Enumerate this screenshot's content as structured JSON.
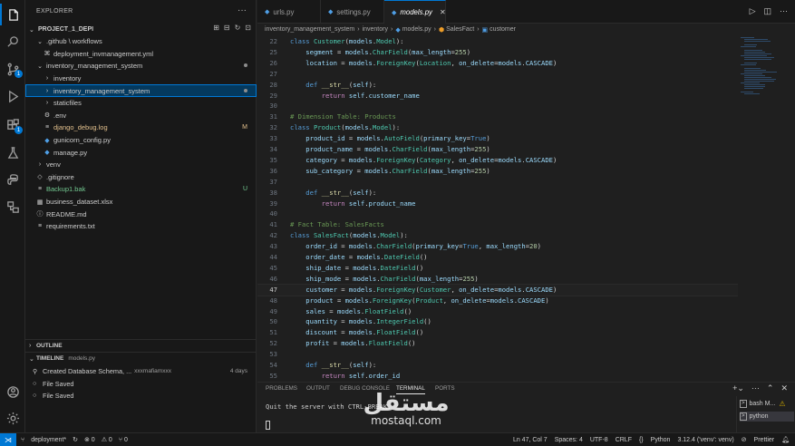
{
  "activity": {
    "items": [
      {
        "name": "explorer-icon",
        "label": "Explorer"
      },
      {
        "name": "search-icon",
        "label": "Search"
      },
      {
        "name": "source-control-icon",
        "label": "Source Control",
        "badge": "1"
      },
      {
        "name": "run-debug-icon",
        "label": "Run and Debug"
      },
      {
        "name": "extensions-icon",
        "label": "Extensions",
        "badge": "1"
      },
      {
        "name": "testing-icon",
        "label": "Testing"
      },
      {
        "name": "python-icon",
        "label": "Python"
      },
      {
        "name": "remote-explorer-icon",
        "label": "Remote Explorer"
      }
    ]
  },
  "explorer": {
    "title": "EXPLORER",
    "more": "···",
    "project": "PROJECT_1_DEPI",
    "items": [
      {
        "label": ".github \\ workflows",
        "icon": "⌄",
        "indent": 1,
        "git": ""
      },
      {
        "label": "deployment_invmanagement.yml",
        "icon": "⌘",
        "indent": 2,
        "git": ""
      },
      {
        "label": "inventory_management_system",
        "icon": "⌄",
        "indent": 1,
        "git": "dot"
      },
      {
        "label": "inventory",
        "icon": "›",
        "indent": 2,
        "git": ""
      },
      {
        "label": "inventory_management_system",
        "icon": "›",
        "indent": 2,
        "git": "dot",
        "selected": true
      },
      {
        "label": "staticfiles",
        "icon": "›",
        "indent": 2,
        "git": ""
      },
      {
        "label": ".env",
        "icon": "⚙",
        "indent": 2,
        "git": ""
      },
      {
        "label": "django_debug.log",
        "icon": "≡",
        "indent": 2,
        "git": "M"
      },
      {
        "label": "gunicorn_config.py",
        "icon": "◆",
        "indent": 2,
        "git": ""
      },
      {
        "label": "manage.py",
        "icon": "◆",
        "indent": 2,
        "git": ""
      },
      {
        "label": "venv",
        "icon": "›",
        "indent": 1,
        "git": ""
      },
      {
        "label": ".gitignore",
        "icon": "◇",
        "indent": 1,
        "git": ""
      },
      {
        "label": "Backup1.bak",
        "icon": "≡",
        "indent": 1,
        "git": "U"
      },
      {
        "label": "business_dataset.xlsx",
        "icon": "▦",
        "indent": 1,
        "git": ""
      },
      {
        "label": "README.md",
        "icon": "ⓘ",
        "indent": 1,
        "git": ""
      },
      {
        "label": "requirements.txt",
        "icon": "≡",
        "indent": 1,
        "git": ""
      }
    ],
    "outline": "OUTLINE",
    "timeline": "TIMELINE",
    "timeline_file": "models.py",
    "timeline_items": [
      {
        "icon": "⚲",
        "label": "Created Database Schema, ...",
        "sub": "xxxmafiamxxx",
        "time": "4 days"
      },
      {
        "icon": "○",
        "label": "File Saved",
        "sub": "",
        "time": ""
      },
      {
        "icon": "○",
        "label": "File Saved",
        "sub": "",
        "time": ""
      }
    ]
  },
  "tabs": [
    {
      "label": "urls.py",
      "active": false
    },
    {
      "label": "settings.py",
      "active": false
    },
    {
      "label": "models.py",
      "active": true
    }
  ],
  "breadcrumb": {
    "parts": [
      "inventory_management_system",
      "inventory",
      "models.py",
      "SalesFact",
      "customer"
    ]
  },
  "code": {
    "current_line": 47,
    "lines": [
      {
        "n": "22",
        "t": [
          [
            "class ",
            "k"
          ],
          [
            "Customer",
            "c"
          ],
          [
            "(",
            "p"
          ],
          [
            "models",
            "v"
          ],
          [
            ".",
            "p"
          ],
          [
            "Model",
            "c"
          ],
          [
            "):",
            "p"
          ]
        ]
      },
      {
        "n": "25",
        "t": [
          [
            "    segment ",
            "v"
          ],
          [
            "= ",
            "p"
          ],
          [
            "models",
            "v"
          ],
          [
            ".",
            "p"
          ],
          [
            "CharField",
            "c"
          ],
          [
            "(",
            "p"
          ],
          [
            "max_length",
            "v"
          ],
          [
            "=",
            "p"
          ],
          [
            "255",
            "n"
          ],
          [
            ")",
            "p"
          ]
        ]
      },
      {
        "n": "26",
        "t": [
          [
            "    location ",
            "v"
          ],
          [
            "= ",
            "p"
          ],
          [
            "models",
            "v"
          ],
          [
            ".",
            "p"
          ],
          [
            "ForeignKey",
            "c"
          ],
          [
            "(",
            "p"
          ],
          [
            "Location",
            "c"
          ],
          [
            ", ",
            "p"
          ],
          [
            "on_delete",
            "v"
          ],
          [
            "=",
            "p"
          ],
          [
            "models",
            "v"
          ],
          [
            ".",
            "p"
          ],
          [
            "CASCADE",
            "v"
          ],
          [
            ")",
            "p"
          ]
        ]
      },
      {
        "n": "27",
        "t": []
      },
      {
        "n": "28",
        "t": [
          [
            "    def ",
            "k"
          ],
          [
            "__str__",
            "f"
          ],
          [
            "(",
            "p"
          ],
          [
            "self",
            "v"
          ],
          [
            "):",
            "p"
          ]
        ]
      },
      {
        "n": "29",
        "t": [
          [
            "        return ",
            "kw"
          ],
          [
            "self",
            "v"
          ],
          [
            ".",
            "p"
          ],
          [
            "customer_name",
            "v"
          ]
        ]
      },
      {
        "n": "30",
        "t": []
      },
      {
        "n": "31",
        "t": [
          [
            "# Dimension Table: Products",
            "cm"
          ]
        ]
      },
      {
        "n": "32",
        "t": [
          [
            "class ",
            "k"
          ],
          [
            "Product",
            "c"
          ],
          [
            "(",
            "p"
          ],
          [
            "models",
            "v"
          ],
          [
            ".",
            "p"
          ],
          [
            "Model",
            "c"
          ],
          [
            "):",
            "p"
          ]
        ]
      },
      {
        "n": "33",
        "t": [
          [
            "    product_id ",
            "v"
          ],
          [
            "= ",
            "p"
          ],
          [
            "models",
            "v"
          ],
          [
            ".",
            "p"
          ],
          [
            "AutoField",
            "c"
          ],
          [
            "(",
            "p"
          ],
          [
            "primary_key",
            "v"
          ],
          [
            "=",
            "p"
          ],
          [
            "True",
            "k"
          ],
          [
            ")",
            "p"
          ]
        ]
      },
      {
        "n": "34",
        "t": [
          [
            "    product_name ",
            "v"
          ],
          [
            "= ",
            "p"
          ],
          [
            "models",
            "v"
          ],
          [
            ".",
            "p"
          ],
          [
            "CharField",
            "c"
          ],
          [
            "(",
            "p"
          ],
          [
            "max_length",
            "v"
          ],
          [
            "=",
            "p"
          ],
          [
            "255",
            "n"
          ],
          [
            ")",
            "p"
          ]
        ]
      },
      {
        "n": "35",
        "t": [
          [
            "    category ",
            "v"
          ],
          [
            "= ",
            "p"
          ],
          [
            "models",
            "v"
          ],
          [
            ".",
            "p"
          ],
          [
            "ForeignKey",
            "c"
          ],
          [
            "(",
            "p"
          ],
          [
            "Category",
            "c"
          ],
          [
            ", ",
            "p"
          ],
          [
            "on_delete",
            "v"
          ],
          [
            "=",
            "p"
          ],
          [
            "models",
            "v"
          ],
          [
            ".",
            "p"
          ],
          [
            "CASCADE",
            "v"
          ],
          [
            ")",
            "p"
          ]
        ]
      },
      {
        "n": "36",
        "t": [
          [
            "    sub_category ",
            "v"
          ],
          [
            "= ",
            "p"
          ],
          [
            "models",
            "v"
          ],
          [
            ".",
            "p"
          ],
          [
            "CharField",
            "c"
          ],
          [
            "(",
            "p"
          ],
          [
            "max_length",
            "v"
          ],
          [
            "=",
            "p"
          ],
          [
            "255",
            "n"
          ],
          [
            ")",
            "p"
          ]
        ]
      },
      {
        "n": "37",
        "t": []
      },
      {
        "n": "38",
        "t": [
          [
            "    def ",
            "k"
          ],
          [
            "__str__",
            "f"
          ],
          [
            "(",
            "p"
          ],
          [
            "self",
            "v"
          ],
          [
            "):",
            "p"
          ]
        ]
      },
      {
        "n": "39",
        "t": [
          [
            "        return ",
            "kw"
          ],
          [
            "self",
            "v"
          ],
          [
            ".",
            "p"
          ],
          [
            "product_name",
            "v"
          ]
        ]
      },
      {
        "n": "40",
        "t": []
      },
      {
        "n": "41",
        "t": [
          [
            "# Fact Table: SalesFacts",
            "cm"
          ]
        ]
      },
      {
        "n": "42",
        "t": [
          [
            "class ",
            "k"
          ],
          [
            "SalesFact",
            "c"
          ],
          [
            "(",
            "p"
          ],
          [
            "models",
            "v"
          ],
          [
            ".",
            "p"
          ],
          [
            "Model",
            "c"
          ],
          [
            "):",
            "p"
          ]
        ]
      },
      {
        "n": "43",
        "t": [
          [
            "    order_id ",
            "v"
          ],
          [
            "= ",
            "p"
          ],
          [
            "models",
            "v"
          ],
          [
            ".",
            "p"
          ],
          [
            "CharField",
            "c"
          ],
          [
            "(",
            "p"
          ],
          [
            "primary_key",
            "v"
          ],
          [
            "=",
            "p"
          ],
          [
            "True",
            "k"
          ],
          [
            ", ",
            "p"
          ],
          [
            "max_length",
            "v"
          ],
          [
            "=",
            "p"
          ],
          [
            "20",
            "n"
          ],
          [
            ")",
            "p"
          ]
        ]
      },
      {
        "n": "44",
        "t": [
          [
            "    order_date ",
            "v"
          ],
          [
            "= ",
            "p"
          ],
          [
            "models",
            "v"
          ],
          [
            ".",
            "p"
          ],
          [
            "DateField",
            "c"
          ],
          [
            "()",
            "p"
          ]
        ]
      },
      {
        "n": "45",
        "t": [
          [
            "    ship_date ",
            "v"
          ],
          [
            "= ",
            "p"
          ],
          [
            "models",
            "v"
          ],
          [
            ".",
            "p"
          ],
          [
            "DateField",
            "c"
          ],
          [
            "()",
            "p"
          ]
        ]
      },
      {
        "n": "46",
        "t": [
          [
            "    ship_mode ",
            "v"
          ],
          [
            "= ",
            "p"
          ],
          [
            "models",
            "v"
          ],
          [
            ".",
            "p"
          ],
          [
            "CharField",
            "c"
          ],
          [
            "(",
            "p"
          ],
          [
            "max_length",
            "v"
          ],
          [
            "=",
            "p"
          ],
          [
            "255",
            "n"
          ],
          [
            ")",
            "p"
          ]
        ]
      },
      {
        "n": "47",
        "t": [
          [
            "    customer ",
            "v"
          ],
          [
            "= ",
            "p"
          ],
          [
            "models",
            "v"
          ],
          [
            ".",
            "p"
          ],
          [
            "ForeignKey",
            "c"
          ],
          [
            "(",
            "p"
          ],
          [
            "Customer",
            "c"
          ],
          [
            ", ",
            "p"
          ],
          [
            "on_delete",
            "v"
          ],
          [
            "=",
            "p"
          ],
          [
            "models",
            "v"
          ],
          [
            ".",
            "p"
          ],
          [
            "CASCADE",
            "v"
          ],
          [
            ")",
            "p"
          ]
        ]
      },
      {
        "n": "48",
        "t": [
          [
            "    product ",
            "v"
          ],
          [
            "= ",
            "p"
          ],
          [
            "models",
            "v"
          ],
          [
            ".",
            "p"
          ],
          [
            "ForeignKey",
            "c"
          ],
          [
            "(",
            "p"
          ],
          [
            "Product",
            "c"
          ],
          [
            ", ",
            "p"
          ],
          [
            "on_delete",
            "v"
          ],
          [
            "=",
            "p"
          ],
          [
            "models",
            "v"
          ],
          [
            ".",
            "p"
          ],
          [
            "CASCADE",
            "v"
          ],
          [
            ")",
            "p"
          ]
        ]
      },
      {
        "n": "49",
        "t": [
          [
            "    sales ",
            "v"
          ],
          [
            "= ",
            "p"
          ],
          [
            "models",
            "v"
          ],
          [
            ".",
            "p"
          ],
          [
            "FloatField",
            "c"
          ],
          [
            "()",
            "p"
          ]
        ]
      },
      {
        "n": "50",
        "t": [
          [
            "    quantity ",
            "v"
          ],
          [
            "= ",
            "p"
          ],
          [
            "models",
            "v"
          ],
          [
            ".",
            "p"
          ],
          [
            "IntegerField",
            "c"
          ],
          [
            "()",
            "p"
          ]
        ]
      },
      {
        "n": "51",
        "t": [
          [
            "    discount ",
            "v"
          ],
          [
            "= ",
            "p"
          ],
          [
            "models",
            "v"
          ],
          [
            ".",
            "p"
          ],
          [
            "FloatField",
            "c"
          ],
          [
            "()",
            "p"
          ]
        ]
      },
      {
        "n": "52",
        "t": [
          [
            "    profit ",
            "v"
          ],
          [
            "= ",
            "p"
          ],
          [
            "models",
            "v"
          ],
          [
            ".",
            "p"
          ],
          [
            "FloatField",
            "c"
          ],
          [
            "()",
            "p"
          ]
        ]
      },
      {
        "n": "53",
        "t": []
      },
      {
        "n": "54",
        "t": [
          [
            "    def ",
            "k"
          ],
          [
            "__str__",
            "f"
          ],
          [
            "(",
            "p"
          ],
          [
            "self",
            "v"
          ],
          [
            "):",
            "p"
          ]
        ]
      },
      {
        "n": "55",
        "t": [
          [
            "        return ",
            "kw"
          ],
          [
            "self",
            "v"
          ],
          [
            ".",
            "p"
          ],
          [
            "order_id",
            "v"
          ]
        ]
      }
    ]
  },
  "panel": {
    "tabs": [
      "PROBLEMS",
      "OUTPUT",
      "DEBUG CONSOLE",
      "TERMINAL",
      "PORTS"
    ],
    "active_tab": "TERMINAL",
    "terminal_text": "Quit the server with CTRL-BREAK.",
    "terminals": [
      {
        "label": "bash M...",
        "warn": true
      },
      {
        "label": "python",
        "warn": false
      }
    ]
  },
  "watermark": {
    "arabic": "مستقل",
    "latin": "mostaql.com"
  },
  "status": {
    "branch": "deployment*",
    "errors": "⊗ 0",
    "warnings": "⚠ 0",
    "ports": "⑂ 0",
    "position": "Ln 47, Col 7",
    "spaces": "Spaces: 4",
    "encoding": "UTF-8",
    "eol": "CRLF",
    "language": "Python",
    "interpreter": "3.12.4 ('venv': venv)",
    "prettier": "Prettier"
  },
  "colors": {
    "accent": "#0078d4",
    "selection": "#04395e",
    "background": "#1f1f1f",
    "sidebar": "#181818",
    "modified": "#e2c08d",
    "untracked": "#73c991"
  }
}
